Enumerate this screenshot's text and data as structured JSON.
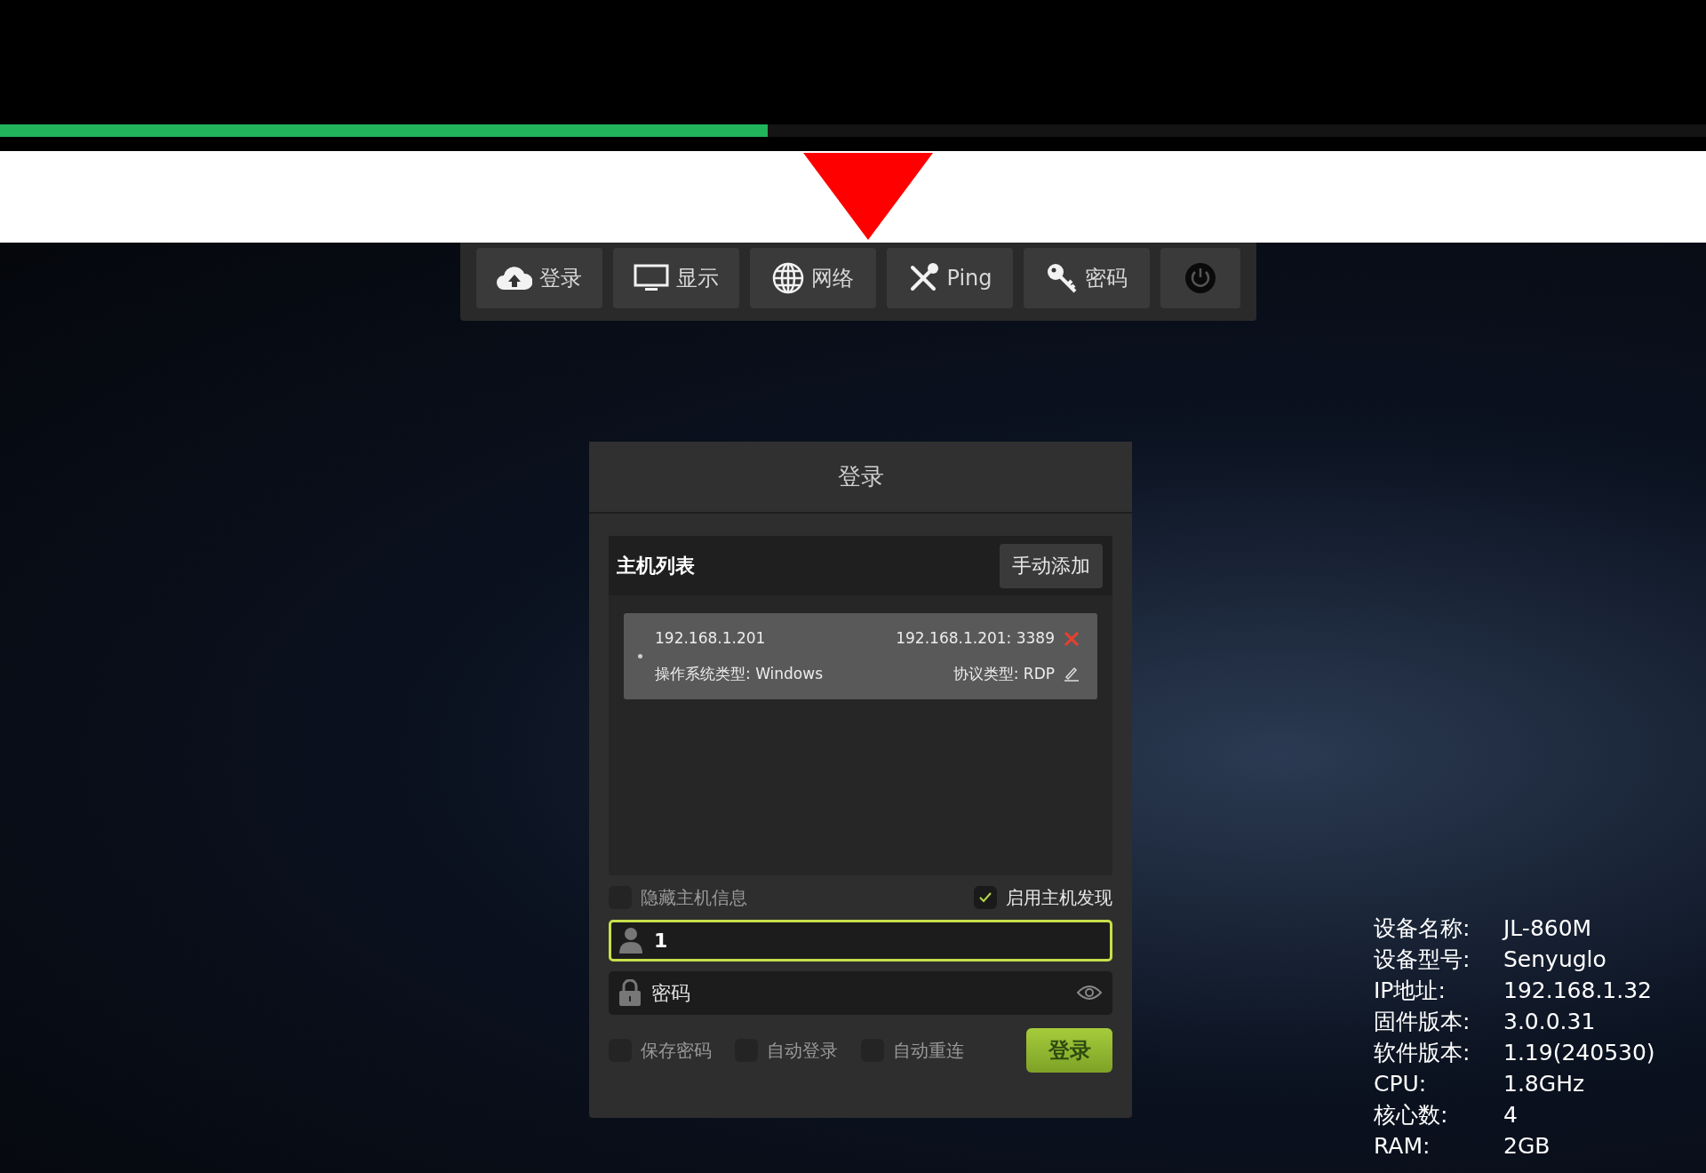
{
  "progress": {
    "level": 0.45
  },
  "toolbar": [
    {
      "kind": "upload",
      "label": "登录"
    },
    {
      "kind": "monitor",
      "label": "显示"
    },
    {
      "kind": "globe",
      "label": "网络"
    },
    {
      "kind": "tools",
      "label": "Ping"
    },
    {
      "kind": "key",
      "label": "密码"
    },
    {
      "kind": "power"
    }
  ],
  "dialog": {
    "title": "登录",
    "host_list": {
      "title": "主机列表",
      "add_button": "手动添加",
      "hosts": [
        {
          "name": "192.168.1.201",
          "address": "192.168.1.201: 3389",
          "os": "操作系统类型: Windows",
          "protocol": "协议类型: RDP"
        }
      ]
    },
    "options": [
      {
        "label": "隐藏主机信息",
        "checked": false
      },
      {
        "label": "启用主机发现",
        "checked": true
      }
    ],
    "username": {
      "value": "1"
    },
    "password": {
      "placeholder": "密码"
    },
    "login_options": [
      {
        "label": "保存密码",
        "checked": false
      },
      {
        "label": "自动登录",
        "checked": false
      },
      {
        "label": "自动重连",
        "checked": false
      }
    ],
    "login_button": "登录"
  },
  "device_info": [
    {
      "label": "设备名称:",
      "value": "JL-860M"
    },
    {
      "label": "设备型号:",
      "value": "Senyuglo"
    },
    {
      "label": "IP地址:",
      "value": "192.168.1.32"
    },
    {
      "label": "固件版本:",
      "value": "3.0.0.31"
    },
    {
      "label": "软件版本:",
      "value": "1.19(240530)"
    },
    {
      "label": "CPU:",
      "value": "1.8GHz"
    },
    {
      "label": "核心数:",
      "value": "4"
    },
    {
      "label": "RAM:",
      "value": "2GB"
    }
  ]
}
